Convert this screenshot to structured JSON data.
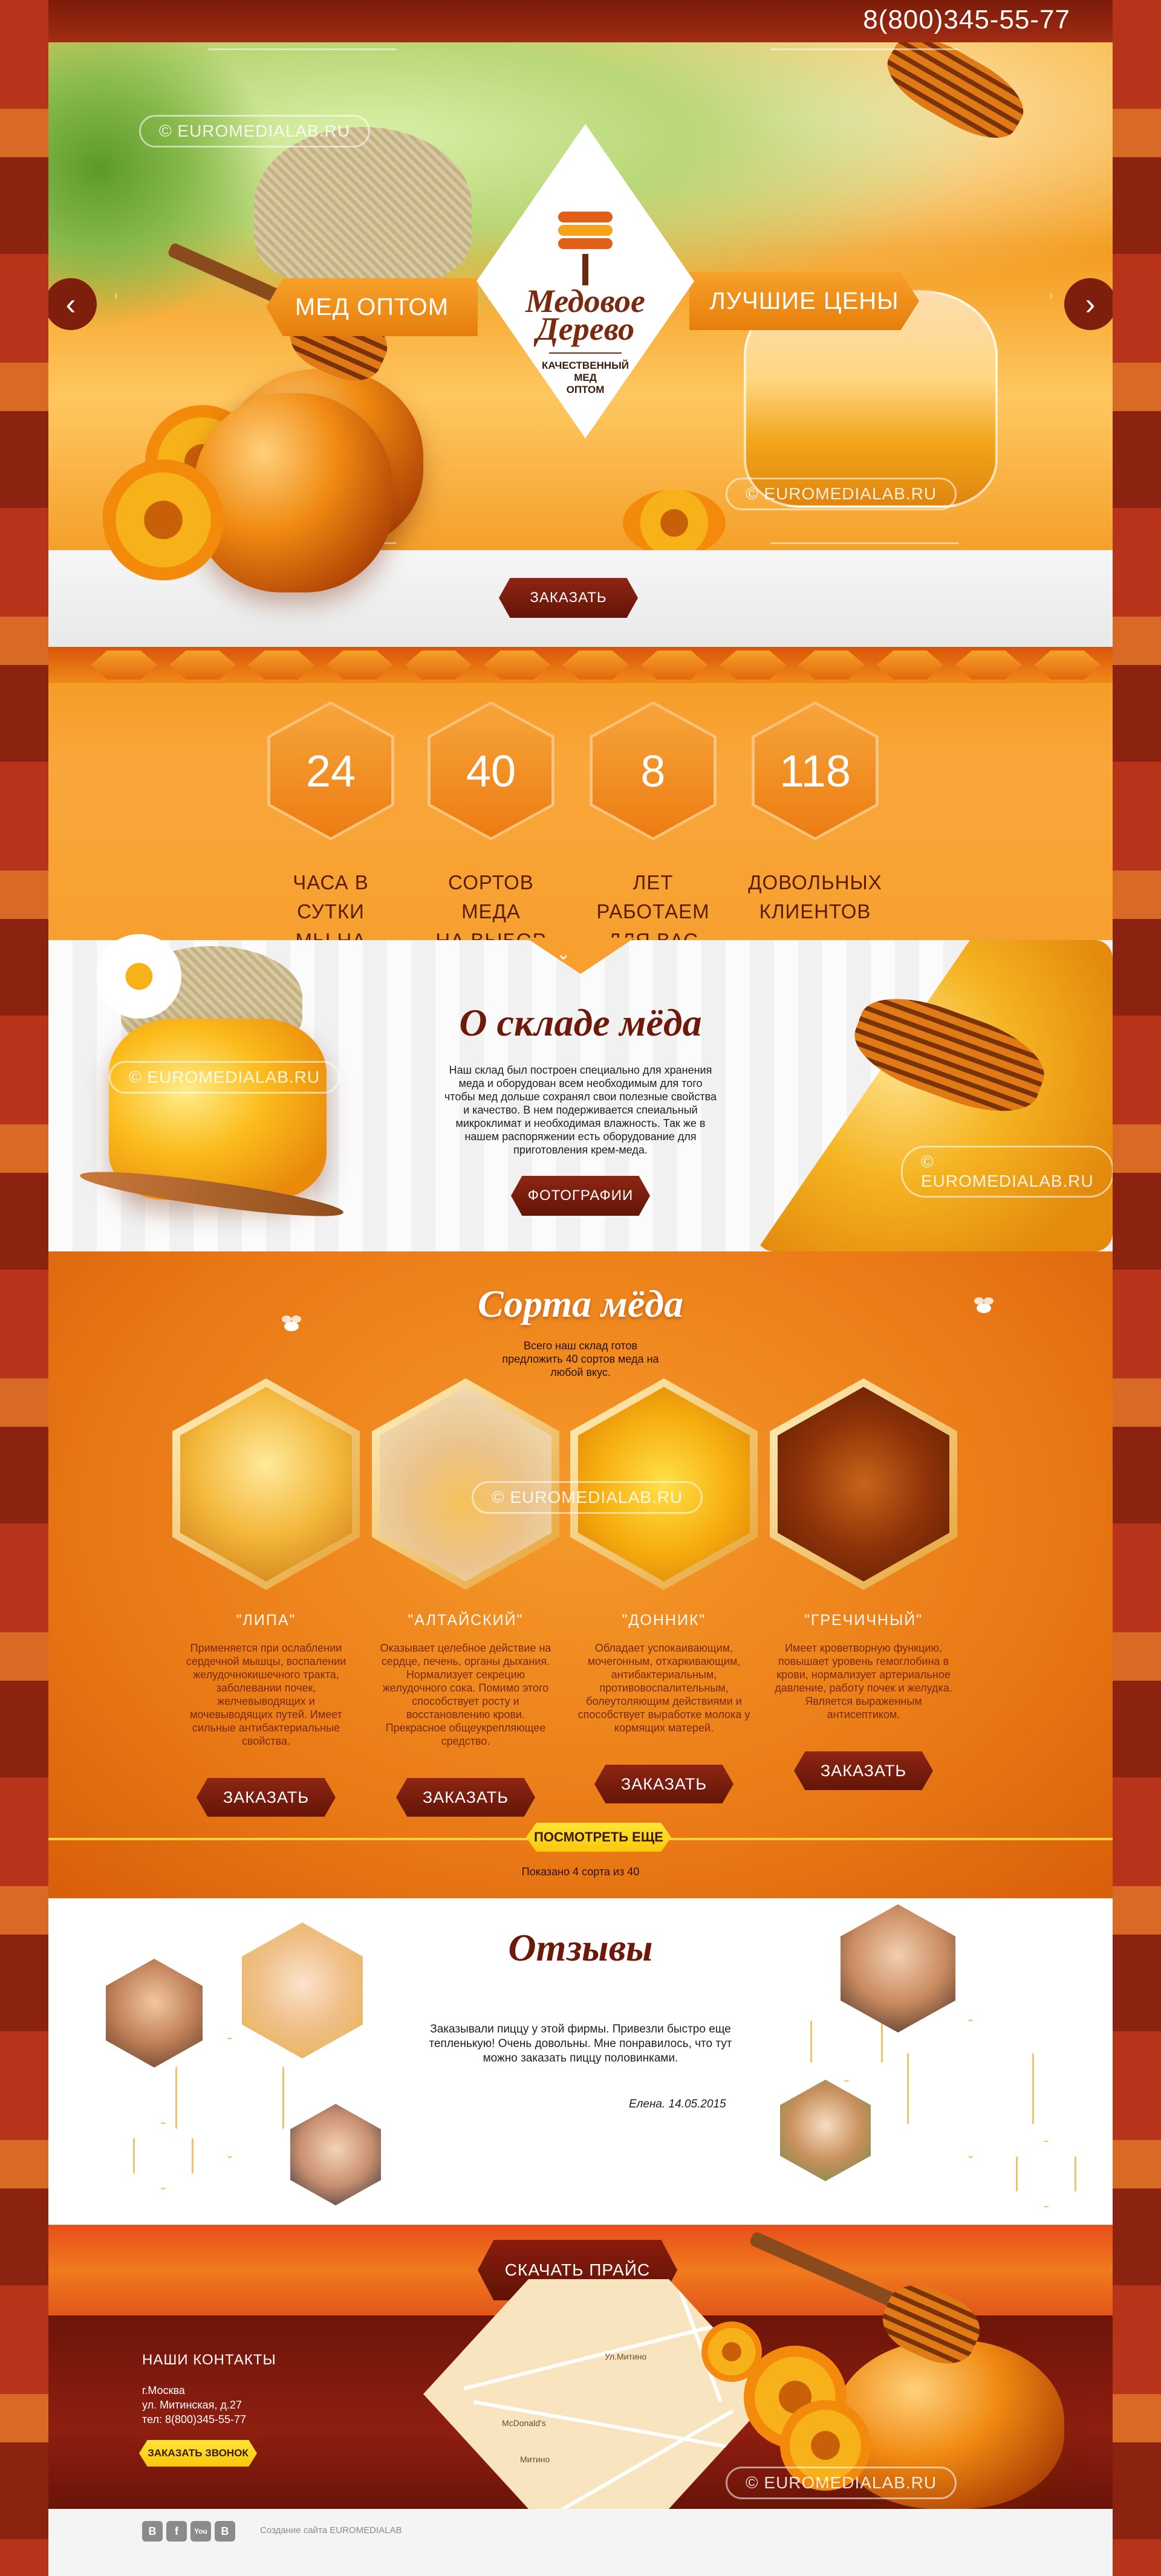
{
  "header": {
    "phone": "8(800)345-55-77",
    "slider_prev_label": "‹",
    "slider_next_label": "›"
  },
  "hero": {
    "ribbon_left": "МЕД ОПТОМ",
    "ribbon_right": "ЛУЧШИЕ ЦЕНЫ",
    "logo_title_1": "Медовое",
    "logo_title_2": "Дерево",
    "logo_sub_1": "КАЧЕСТВЕННЫЙ",
    "logo_sub_2": "МЕД",
    "logo_sub_3": "ОПТОМ",
    "watermark": "© EUROMEDIALAB.RU",
    "order_button": "ЗАКАЗАТЬ"
  },
  "stats": [
    {
      "value": "24",
      "line1": "ЧАСА В СУТКИ",
      "line2": "МЫ НА СВЯЗИ"
    },
    {
      "value": "40",
      "line1": "СОРТОВ МЕДА",
      "line2": "НА ВЫБОР"
    },
    {
      "value": "8",
      "line1": "ЛЕТ РАБОТАЕМ",
      "line2": "ДЛЯ ВАС"
    },
    {
      "value": "118",
      "line1": "ДОВОЛЬНЫХ",
      "line2": "КЛИЕНТОВ"
    }
  ],
  "about": {
    "title": "О складе мёда",
    "text_1": "Наш склад был построен специально для хранения",
    "text_2": "меда  и оборудован всем необходимым для того",
    "text_3": "чтобы мед дольше сохранял свои полезные свойства",
    "text_4": "и качество. В нем подерживается спеиальный",
    "text_5": "микроклимат и необходимая влажность. Так же в",
    "text_6": "нашем распоряжении есть оборудование для",
    "text_7": "приготовления крем-меда.",
    "photos_button": "ФОТОГРАФИИ",
    "watermark": "© EUROMEDIALAB.RU"
  },
  "sorts": {
    "title": "Сорта мёда",
    "intro_1": "Всего наш склад готов",
    "intro_2": "предложить 40 сортов меда на",
    "intro_3": "любой вкус.",
    "items": [
      {
        "name": "\"ЛИПА\"",
        "desc": "Применяется при ослаблении сердечной мышцы, воспалении желудочнокишечного тракта, заболевании почек, желчевыводящих и мочевыводящих путей. Имеет сильные антибактериальные свойства.",
        "button": "ЗАКАЗАТЬ"
      },
      {
        "name": "\"АЛТАЙСКИЙ\"",
        "desc": "Оказывает целебное действие на сердце, печень, органы дыхания. Нормализует секрецию желудочного сока. Помимо этого способствует росту и восстановлению крови. Прекрасное общеукрепляющее средство.",
        "button": "ЗАКАЗАТЬ"
      },
      {
        "name": "\"ДОННИК\"",
        "desc": "Обладает успокаивающим, мочегонным, отхаркивающим, антибактериальным, противовоспалительным, болеутоляющим действиями и способствует выработке молока у кормящих матерей.",
        "button": "ЗАКАЗАТЬ"
      },
      {
        "name": "\"ГРЕЧИЧНЫЙ\"",
        "desc": "Имеет кроветворную функцию, повышает уровень гемоглобина в крови, нормализует артериальное давление, работу почек и желудка. Является выраженным антисептиком.",
        "button": "ЗАКАЗАТЬ"
      }
    ],
    "more_button": "ПОСМОТРЕТЬ ЕЩЕ",
    "shown_text": "Показано 4 сорта из 40",
    "watermark": "© EUROMEDIALAB.RU"
  },
  "reviews": {
    "title": "Отзывы",
    "text_1": "Заказывали пиццу у этой фирмы. Привезли быстро еще",
    "text_2": "тепленькую! Очень довольны. Мне понравилось, что тут",
    "text_3": "можно заказать пиццу половинками.",
    "author": "Елена. 14.05.2015"
  },
  "price": {
    "button": "СКАЧАТЬ ПРАЙС"
  },
  "footer": {
    "contacts_title": "НАШИ КОНТАКТЫ",
    "city": "г.Москва",
    "street": "ул. Митинская, д.27",
    "phone": "тел: 8(800)345-55-77",
    "callback_button": "ЗАКАЗАТЬ ЗВОНОК",
    "map_label_1": "Ул.Митино",
    "map_label_2": "McDonald's",
    "map_label_3": "Митино",
    "watermark": "© EUROMEDIALAB.RU",
    "credit": "Создание сайта EUROMEDIALAB",
    "social": [
      "B",
      "f",
      "You",
      "B"
    ]
  },
  "colors": {
    "accent_orange": "#f39b1e",
    "dark_red": "#7e1e0d",
    "yellow_button": "#f9c80b"
  }
}
